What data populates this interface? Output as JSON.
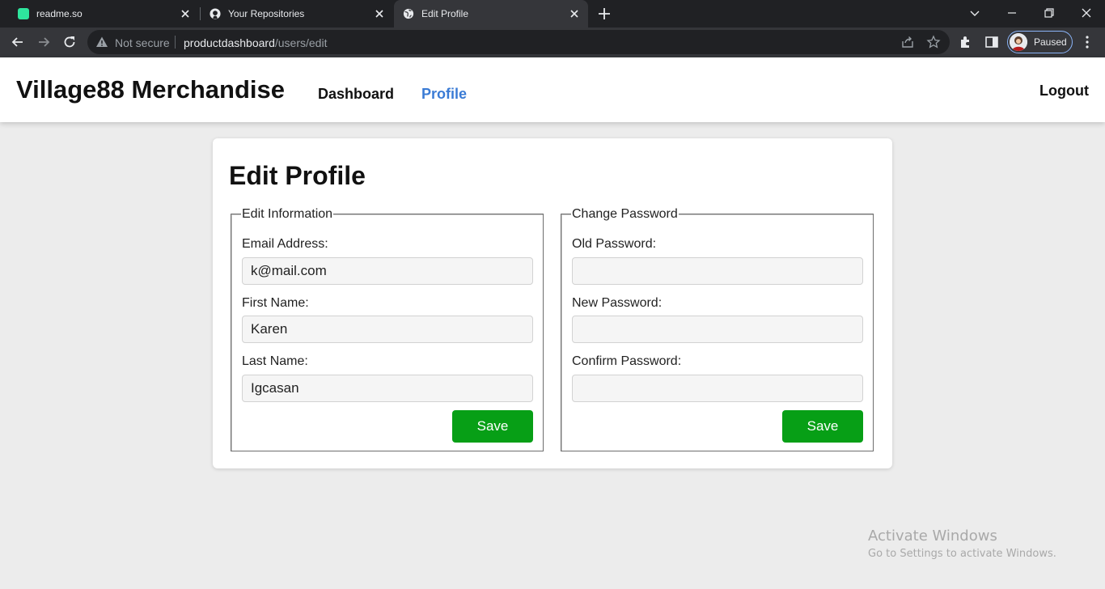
{
  "browser": {
    "tabs": [
      {
        "title": "readme.so",
        "favicon": "readme-icon",
        "color": "#2ee59d"
      },
      {
        "title": "Your Repositories",
        "favicon": "github-icon"
      },
      {
        "title": "Edit Profile",
        "favicon": "globe-icon",
        "active": true
      }
    ],
    "security_label": "Not secure",
    "url_host": "productdashboard",
    "url_path": "/users/edit",
    "profile_status": "Paused"
  },
  "site": {
    "brand": "Village88 Merchandise",
    "nav": {
      "dashboard": "Dashboard",
      "profile": "Profile",
      "logout": "Logout"
    },
    "accent_color": "#3a7bd5"
  },
  "page": {
    "title": "Edit Profile",
    "edit_info": {
      "legend": "Edit Information",
      "email_label": "Email Address:",
      "email_value": "k@mail.com",
      "first_name_label": "First Name:",
      "first_name_value": "Karen",
      "last_name_label": "Last Name:",
      "last_name_value": "Igcasan",
      "save_label": "Save"
    },
    "change_password": {
      "legend": "Change Password",
      "old_label": "Old Password:",
      "old_value": "",
      "new_label": "New Password:",
      "new_value": "",
      "confirm_label": "Confirm Password:",
      "confirm_value": "",
      "save_label": "Save"
    },
    "save_color": "#079f16"
  },
  "watermark": {
    "line1": "Activate Windows",
    "line2": "Go to Settings to activate Windows."
  }
}
